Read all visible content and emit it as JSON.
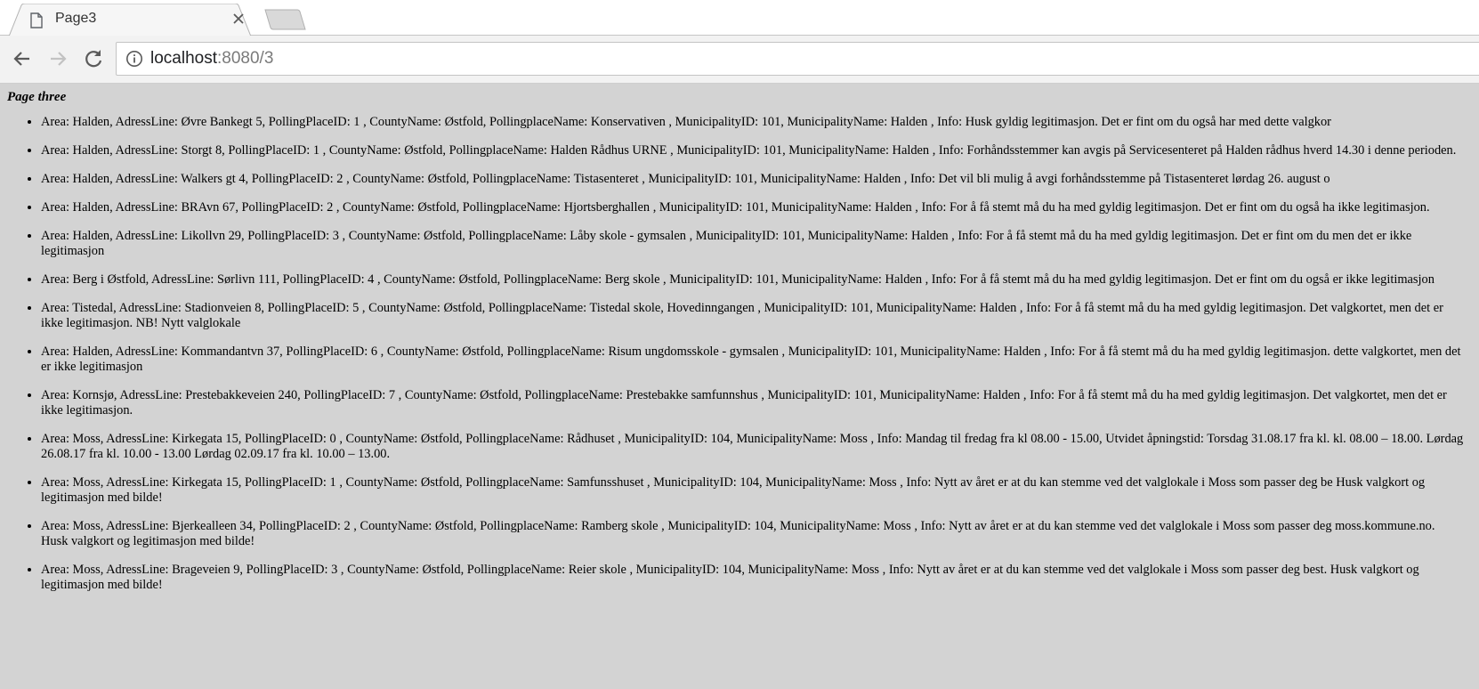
{
  "browser": {
    "tab_title": "Page3",
    "url_host": "localhost",
    "url_rest": ":8080/3"
  },
  "page": {
    "heading": "Page three",
    "items": [
      "Area: Halden, AdressLine: Øvre Bankegt 5, PollingPlaceID: 1 , CountyName: Østfold, PollingplaceName: Konservativen , MunicipalityID: 101, MunicipalityName: Halden , Info: Husk gyldig legitimasjon. Det er fint om du også har med dette valgkor",
      "Area: Halden, AdressLine: Storgt 8, PollingPlaceID: 1 , CountyName: Østfold, PollingplaceName: Halden Rådhus URNE , MunicipalityID: 101, MunicipalityName: Halden , Info: Forhåndsstemmer kan avgis på Servicesenteret på Halden rådhus hverd 14.30 i denne perioden.",
      "Area: Halden, AdressLine: Walkers gt 4, PollingPlaceID: 2 , CountyName: Østfold, PollingplaceName: Tistasenteret , MunicipalityID: 101, MunicipalityName: Halden , Info: Det vil bli mulig å avgi forhåndsstemme på Tistasenteret lørdag 26. august o",
      "Area: Halden, AdressLine: BRAvn 67, PollingPlaceID: 2 , CountyName: Østfold, PollingplaceName: Hjortsberghallen , MunicipalityID: 101, MunicipalityName: Halden , Info: For å få stemt må du ha med gyldig legitimasjon. Det er fint om du også ha ikke legitimasjon.",
      "Area: Halden, AdressLine: Likollvn 29, PollingPlaceID: 3 , CountyName: Østfold, PollingplaceName: Låby skole - gymsalen , MunicipalityID: 101, MunicipalityName: Halden , Info: For å få stemt må du ha med gyldig legitimasjon. Det er fint om du men det er ikke legitimasjon",
      "Area: Berg i Østfold, AdressLine: Sørlivn 111, PollingPlaceID: 4 , CountyName: Østfold, PollingplaceName: Berg skole , MunicipalityID: 101, MunicipalityName: Halden , Info: For å få stemt må du ha med gyldig legitimasjon. Det er fint om du også er ikke legitimasjon",
      "Area: Tistedal, AdressLine: Stadionveien 8, PollingPlaceID: 5 , CountyName: Østfold, PollingplaceName: Tistedal skole, Hovedinngangen , MunicipalityID: 101, MunicipalityName: Halden , Info: For å få stemt må du ha med gyldig legitimasjon. Det valgkortet, men det er ikke legitimasjon. NB! Nytt valglokale",
      "Area: Halden, AdressLine: Kommandantvn 37, PollingPlaceID: 6 , CountyName: Østfold, PollingplaceName: Risum ungdomsskole - gymsalen , MunicipalityID: 101, MunicipalityName: Halden , Info: For å få stemt må du ha med gyldig legitimasjon. dette valgkortet, men det er ikke legitimasjon",
      "Area: Kornsjø, AdressLine: Prestebakkeveien 240, PollingPlaceID: 7 , CountyName: Østfold, PollingplaceName: Prestebakke samfunnshus , MunicipalityID: 101, MunicipalityName: Halden , Info: For å få stemt må du ha med gyldig legitimasjon. Det valgkortet, men det er ikke legitimasjon.",
      "Area: Moss, AdressLine: Kirkegata 15, PollingPlaceID: 0 , CountyName: Østfold, PollingplaceName: Rådhuset , MunicipalityID: 104, MunicipalityName: Moss , Info: Mandag til fredag fra kl 08.00 - 15.00, Utvidet åpningstid: Torsdag 31.08.17 fra kl. kl. 08.00 – 18.00. Lørdag 26.08.17 fra kl. 10.00 - 13.00 Lørdag 02.09.17 fra kl. 10.00 – 13.00.",
      "Area: Moss, AdressLine: Kirkegata 15, PollingPlaceID: 1 , CountyName: Østfold, PollingplaceName: Samfunsshuset , MunicipalityID: 104, MunicipalityName: Moss , Info: Nytt av året er at du kan stemme ved det valglokale i Moss som passer deg be Husk valgkort og legitimasjon med bilde!",
      "Area: Moss, AdressLine: Bjerkealleen 34, PollingPlaceID: 2 , CountyName: Østfold, PollingplaceName: Ramberg skole , MunicipalityID: 104, MunicipalityName: Moss , Info: Nytt av året er at du kan stemme ved det valglokale i Moss som passer deg moss.kommune.no. Husk valgkort og legitimasjon med bilde!",
      "Area: Moss, AdressLine: Brageveien 9, PollingPlaceID: 3 , CountyName: Østfold, PollingplaceName: Reier skole , MunicipalityID: 104, MunicipalityName: Moss , Info: Nytt av året er at du kan stemme ved det valglokale i Moss som passer deg best. Husk valgkort og legitimasjon med bilde!"
    ]
  }
}
